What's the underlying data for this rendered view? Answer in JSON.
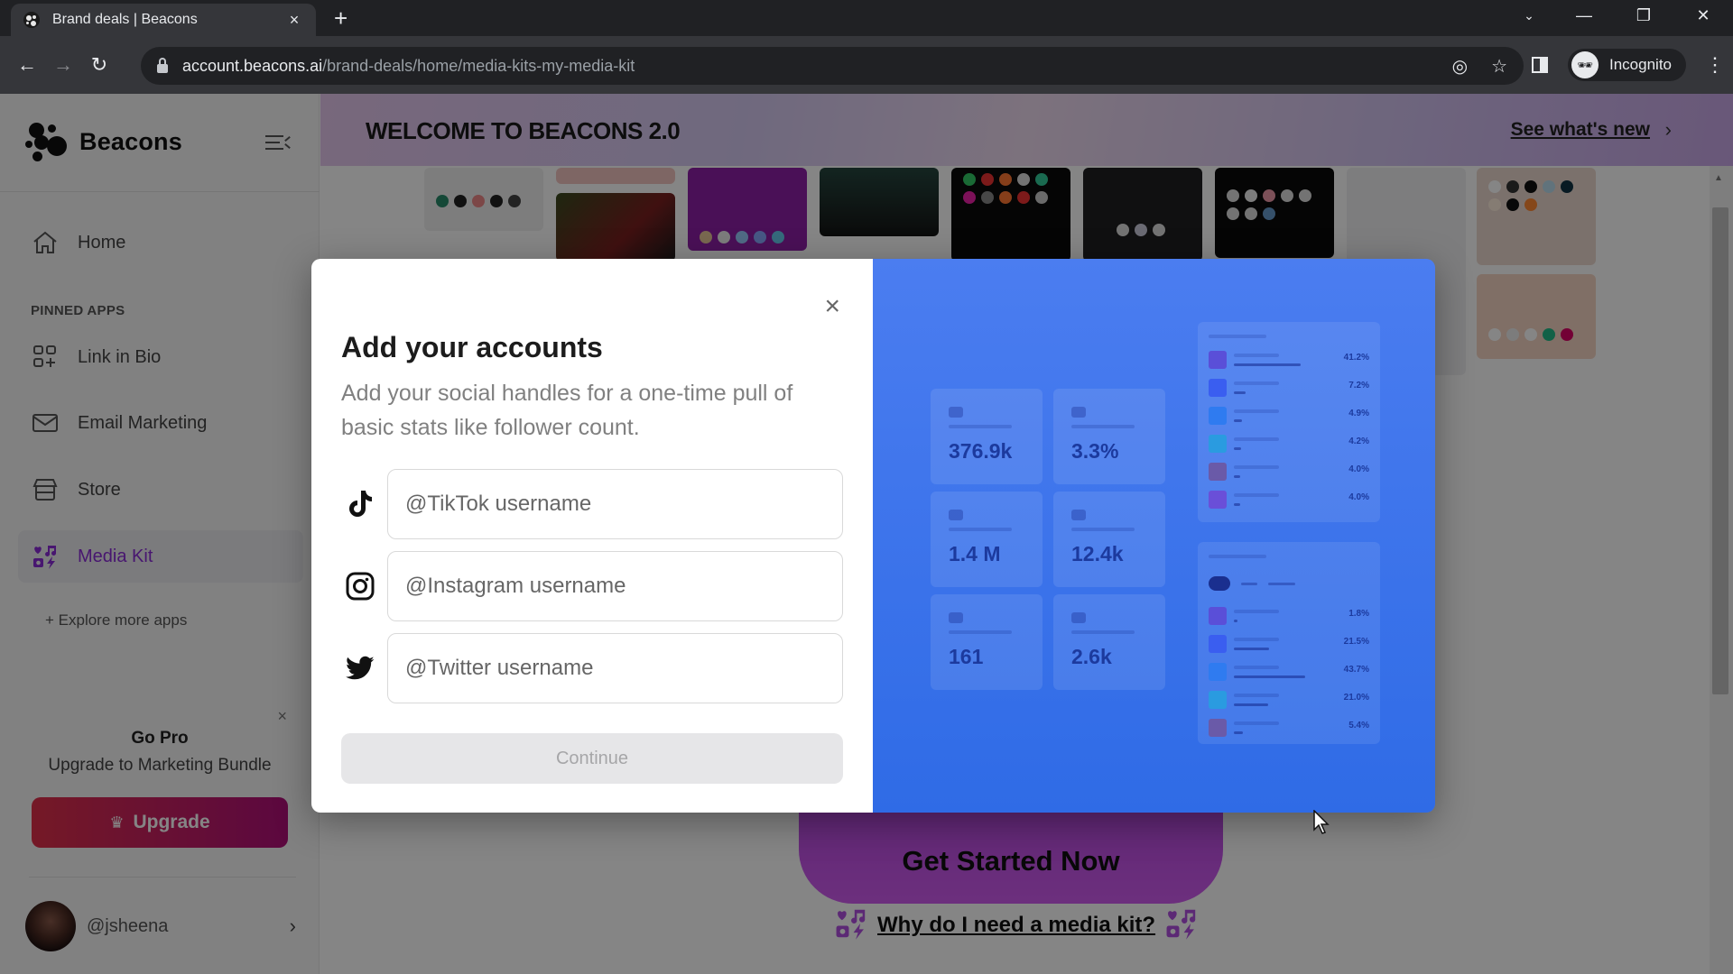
{
  "browser": {
    "tab_title": "Brand deals | Beacons",
    "tab_close": "×",
    "new_tab": "+",
    "url_host": "account.beacons.ai",
    "url_path": "/brand-deals/home/media-kits-my-media-kit",
    "profile_label": "Incognito",
    "window_controls": {
      "tab_search": "⌄",
      "minimize": "—",
      "restore": "❐",
      "close": "✕"
    },
    "nav": {
      "back": "←",
      "forward": "→",
      "reload": "↻"
    },
    "omnibox_icons": {
      "eye_off": "◎",
      "bookmark": "☆"
    },
    "menu": "⋮"
  },
  "sidebar": {
    "brand": "Beacons",
    "items": [
      {
        "label": "Home",
        "icon": "home-icon"
      },
      {
        "label": "Link in Bio",
        "icon": "link-in-bio-icon"
      },
      {
        "label": "Email Marketing",
        "icon": "envelope-icon"
      },
      {
        "label": "Store",
        "icon": "store-icon"
      },
      {
        "label": "Media Kit",
        "icon": "media-kit-icon",
        "active": true
      }
    ],
    "pinned_header": "PINNED APPS",
    "explore_link": "+ Explore more apps",
    "promo": {
      "close": "×",
      "title": "Go Pro",
      "subtitle": "Upgrade to Marketing Bundle",
      "button": "Upgrade",
      "crown": "♛"
    },
    "account": {
      "handle": "@jsheena",
      "chevron": "›"
    }
  },
  "banner": {
    "title": "WELCOME TO BEACONS 2.0",
    "link": "See what's new",
    "chevron": "›"
  },
  "main": {
    "cta": "Get Started Now",
    "why_link": "Why do I need a media kit?"
  },
  "modal": {
    "close": "×",
    "title": "Add your accounts",
    "description": "Add your social handles for a one-time pull of basic stats like follower count.",
    "fields": [
      {
        "platform": "TikTok",
        "icon": "tiktok-icon",
        "value": "",
        "placeholder": "@TikTok username"
      },
      {
        "platform": "Instagram",
        "icon": "instagram-icon",
        "value": "",
        "placeholder": "@Instagram username"
      },
      {
        "platform": "Twitter",
        "icon": "twitter-icon",
        "value": "",
        "placeholder": "@Twitter username"
      }
    ],
    "continue": "Continue",
    "continue_disabled": true,
    "preview": {
      "stats": [
        {
          "value": "376.9k"
        },
        {
          "value": "3.3%"
        },
        {
          "value": "1.4 M"
        },
        {
          "value": "12.4k"
        },
        {
          "value": "161"
        },
        {
          "value": "2.6k"
        }
      ],
      "top_list": [
        {
          "pct": "41.2%",
          "share": 0.412
        },
        {
          "pct": "7.2%",
          "share": 0.072
        },
        {
          "pct": "4.9%",
          "share": 0.049
        },
        {
          "pct": "4.2%",
          "share": 0.042
        },
        {
          "pct": "4.0%",
          "share": 0.04
        },
        {
          "pct": "4.0%",
          "share": 0.04
        }
      ],
      "age_list": [
        {
          "pct": "1.8%",
          "share": 0.018
        },
        {
          "pct": "21.5%",
          "share": 0.215
        },
        {
          "pct": "43.7%",
          "share": 0.437
        },
        {
          "pct": "21.0%",
          "share": 0.21
        },
        {
          "pct": "5.4%",
          "share": 0.054
        }
      ]
    }
  },
  "colors": {
    "accent_purple": "#8a2bd6",
    "upgrade_start": "#e0304a",
    "upgrade_end": "#b0107a",
    "preview_blue": "#3a72ea"
  }
}
